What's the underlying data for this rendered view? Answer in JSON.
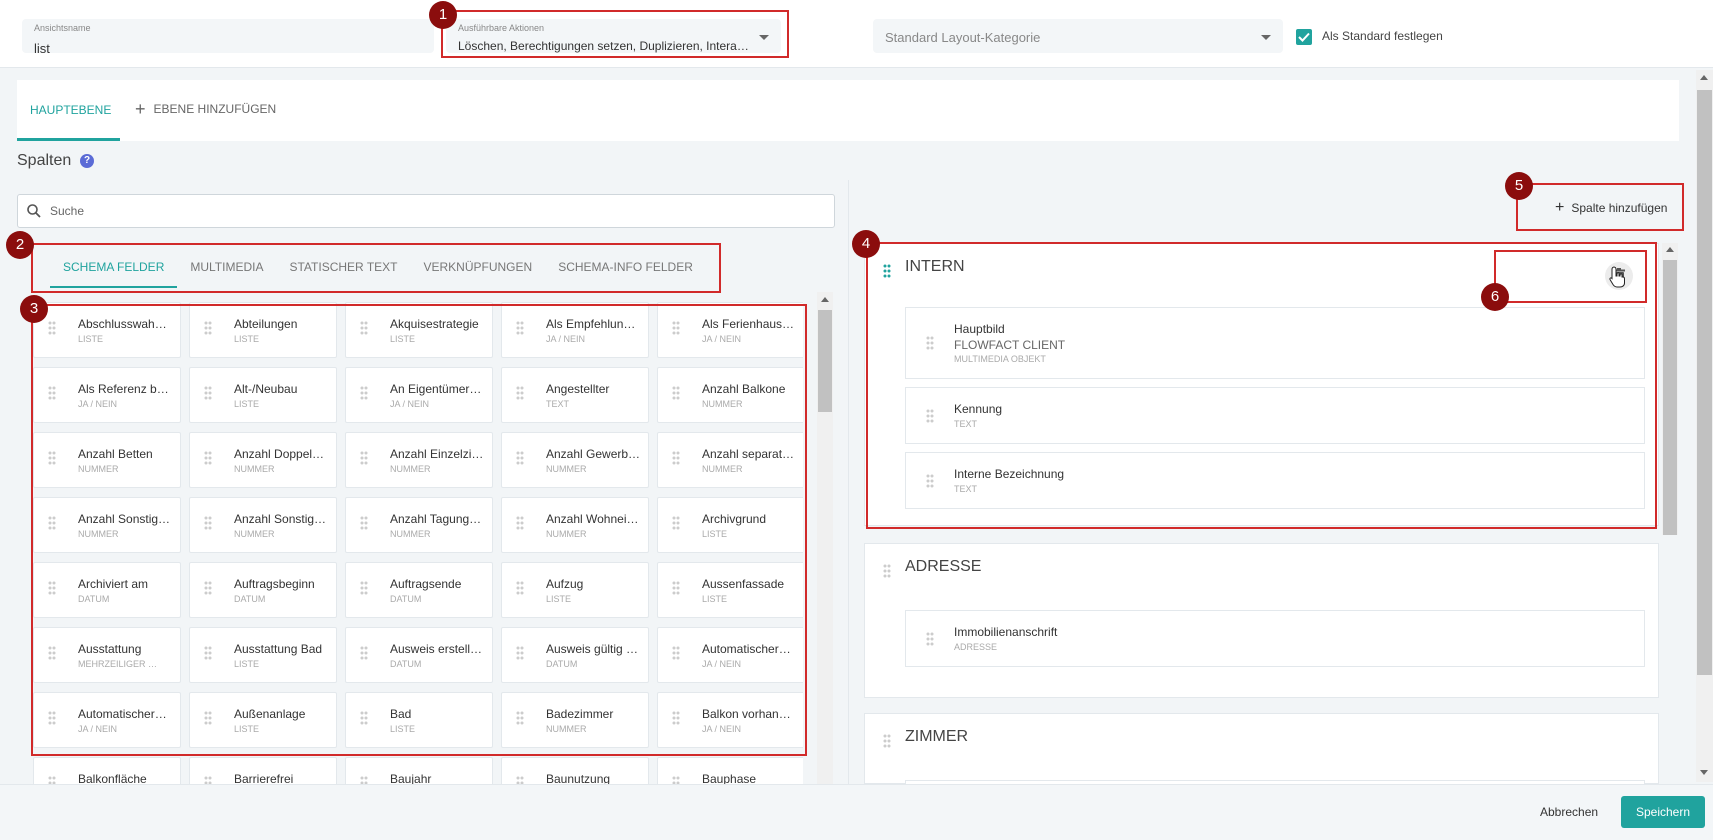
{
  "header": {
    "view_name_label": "Ansichtsname",
    "view_name_value": "list",
    "actions_label": "Ausführbare Aktionen",
    "actions_value": "Löschen, Berechtigungen setzen, Duplizieren, Interak…",
    "layout_category_placeholder": "Standard Layout-Kategorie",
    "default_checkbox_label": "Als Standard festlegen",
    "default_checked": true
  },
  "tabs": {
    "main_label": "HAUPTEBENE",
    "add_level_label": "EBENE HINZUFÜGEN"
  },
  "columns_section": {
    "title": "Spalten",
    "help_icon": "?",
    "search_placeholder": "Suche",
    "subtabs": [
      "SCHEMA FELDER",
      "MULTIMEDIA",
      "STATISCHER TEXT",
      "VERKNÜPFUNGEN",
      "SCHEMA-INFO FELDER"
    ],
    "active_subtab": 0,
    "fields": [
      {
        "name": "Abschlusswah…",
        "type": "LISTE"
      },
      {
        "name": "Abteilungen",
        "type": "LISTE"
      },
      {
        "name": "Akquisestrategie",
        "type": "LISTE"
      },
      {
        "name": "Als Empfehlun…",
        "type": "JA / NEIN"
      },
      {
        "name": "Als Ferienhaus…",
        "type": "JA / NEIN"
      },
      {
        "name": "Als Referenz b…",
        "type": "JA / NEIN"
      },
      {
        "name": "Alt-/Neubau",
        "type": "LISTE"
      },
      {
        "name": "An Eigentümer…",
        "type": "JA / NEIN"
      },
      {
        "name": "Angestellter",
        "type": "TEXT"
      },
      {
        "name": "Anzahl Balkone",
        "type": "NUMMER"
      },
      {
        "name": "Anzahl Betten",
        "type": "NUMMER"
      },
      {
        "name": "Anzahl Doppel…",
        "type": "NUMMER"
      },
      {
        "name": "Anzahl Einzelzi…",
        "type": "NUMMER"
      },
      {
        "name": "Anzahl Gewerb…",
        "type": "NUMMER"
      },
      {
        "name": "Anzahl separat…",
        "type": "NUMMER"
      },
      {
        "name": "Anzahl Sonstig…",
        "type": "NUMMER"
      },
      {
        "name": "Anzahl Sonstig…",
        "type": "NUMMER"
      },
      {
        "name": "Anzahl Tagung…",
        "type": "NUMMER"
      },
      {
        "name": "Anzahl Wohnei…",
        "type": "NUMMER"
      },
      {
        "name": "Archivgrund",
        "type": "LISTE"
      },
      {
        "name": "Archiviert am",
        "type": "DATUM"
      },
      {
        "name": "Auftragsbeginn",
        "type": "DATUM"
      },
      {
        "name": "Auftragsende",
        "type": "DATUM"
      },
      {
        "name": "Aufzug",
        "type": "LISTE"
      },
      {
        "name": "Aussenfassade",
        "type": "LISTE"
      },
      {
        "name": "Ausstattung",
        "type": "MEHRZEILIGER …"
      },
      {
        "name": "Ausstattung Bad",
        "type": "LISTE"
      },
      {
        "name": "Ausweis erstell…",
        "type": "DATUM"
      },
      {
        "name": "Ausweis gültig …",
        "type": "DATUM"
      },
      {
        "name": "Automatischer…",
        "type": "JA / NEIN"
      },
      {
        "name": "Automatischer…",
        "type": "JA / NEIN"
      },
      {
        "name": "Außenanlage",
        "type": "LISTE"
      },
      {
        "name": "Bad",
        "type": "LISTE"
      },
      {
        "name": "Badezimmer",
        "type": "NUMMER"
      },
      {
        "name": "Balkon vorhan…",
        "type": "JA / NEIN"
      },
      {
        "name": "Balkonfläche",
        "type": ""
      },
      {
        "name": "Barrierefrei",
        "type": ""
      },
      {
        "name": "Baujahr",
        "type": ""
      },
      {
        "name": "Baunutzung",
        "type": ""
      },
      {
        "name": "Bauphase",
        "type": ""
      }
    ]
  },
  "right_panel": {
    "add_column_label": "Spalte hinzufügen",
    "groups": [
      {
        "title": "INTERN",
        "fields": [
          {
            "name": "Hauptbild",
            "subname": "FLOWFACT CLIENT",
            "type": "MULTIMEDIA OBJEKT"
          },
          {
            "name": "Kennung",
            "type": "TEXT"
          },
          {
            "name": "Interne Bezeichnung",
            "type": "TEXT"
          }
        ]
      },
      {
        "title": "ADRESSE",
        "fields": [
          {
            "name": "Immobilienanschrift",
            "type": "ADRESSE"
          }
        ]
      },
      {
        "title": "ZIMMER",
        "fields": []
      }
    ]
  },
  "footer": {
    "cancel_label": "Abbrechen",
    "save_label": "Speichern"
  },
  "annotations": [
    "1",
    "2",
    "3",
    "4",
    "5",
    "6"
  ],
  "colors": {
    "accent": "#20a39e",
    "annotation_border": "#d12a2a",
    "annotation_badge": "#8b0d0d"
  }
}
